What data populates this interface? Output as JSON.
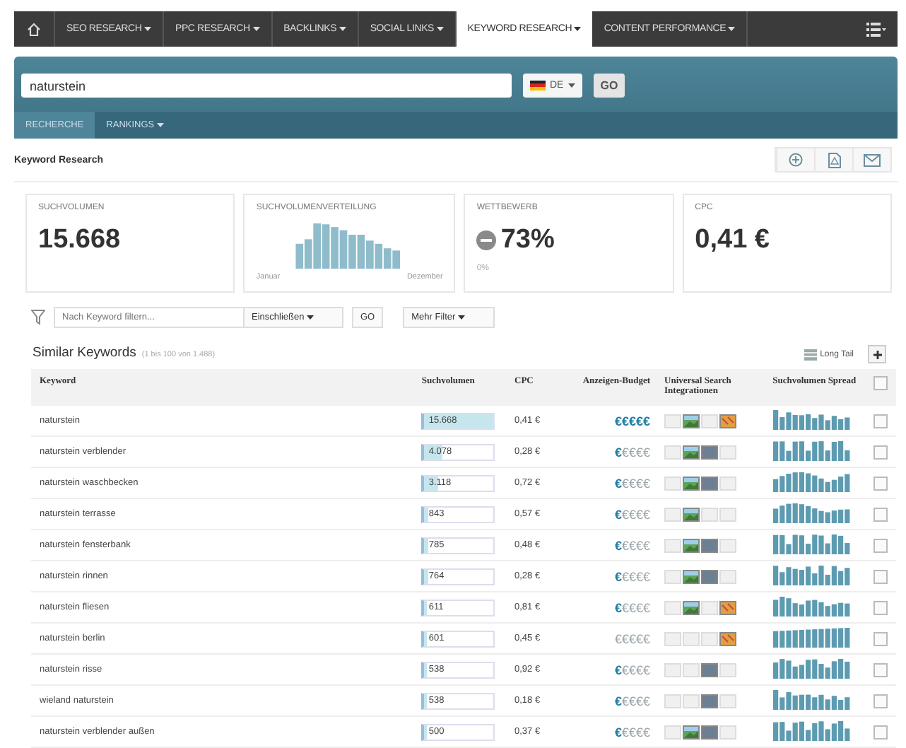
{
  "nav": {
    "items": [
      {
        "label": "SEO RESEARCH",
        "selected": false
      },
      {
        "label": "PPC RESEARCH",
        "selected": false
      },
      {
        "label": "BACKLINKS",
        "selected": false
      },
      {
        "label": "SOCIAL LINKS",
        "selected": false
      },
      {
        "label": "KEYWORD RESEARCH",
        "selected": true
      },
      {
        "label": "CONTENT PERFORMANCE",
        "selected": false
      }
    ]
  },
  "search": {
    "value": "naturstein",
    "country": "DE",
    "go": "GO"
  },
  "subtabs": [
    {
      "label": "RECHERCHE",
      "selected": true,
      "dropdown": false
    },
    {
      "label": "RANKINGS",
      "selected": false,
      "dropdown": true
    }
  ],
  "page_title": "Keyword Research",
  "cards": [
    {
      "kind": "number",
      "label": "SUCHVOLUMEN",
      "value": "15.668"
    },
    {
      "kind": "distribution",
      "label": "SUCHVOLUMENVERTEILUNG",
      "start": "Januar",
      "end": "Dezember"
    },
    {
      "kind": "competition",
      "label": "WETTBEWERB",
      "value": "73%",
      "note": "0%"
    },
    {
      "kind": "number",
      "label": "CPC",
      "value": "0,41 €"
    }
  ],
  "filter": {
    "placeholder": "Nach Keyword filtern...",
    "mode": "Einschließen",
    "go": "GO",
    "more": "Mehr Filter"
  },
  "table": {
    "title": "Similar Keywords",
    "count": "(1 bis 100 von 1.488)",
    "long_tail": "Long Tail",
    "columns": [
      "Keyword",
      "Suchvolumen",
      "CPC",
      "Anzeigen-Budget",
      "Universal Search Integrationen",
      "Suchvolumen Spread"
    ],
    "header_checked": false,
    "rows": [
      {
        "keyword": "naturstein",
        "volume": "15.668",
        "level": 1.0,
        "cpc": "0,41 €",
        "budget": [
          {
            "sign": "€",
            "on": true
          },
          {
            "sign": "€",
            "on": true
          },
          {
            "sign": "€",
            "on": true
          },
          {
            "sign": "€",
            "on": true
          },
          {
            "sign": "€",
            "on": true
          }
        ],
        "integrations": [
          {
            "kind": "news",
            "on": false
          },
          {
            "kind": "image",
            "on": true
          },
          {
            "kind": "video",
            "on": false
          },
          {
            "kind": "map",
            "on": true
          }
        ],
        "checked": false
      },
      {
        "keyword": "naturstein verblender",
        "volume": "4.078",
        "level": 0.26,
        "cpc": "0,28 €",
        "budget": [
          {
            "sign": "€",
            "on": true
          },
          {
            "sign": "€",
            "on": false
          },
          {
            "sign": "€",
            "on": false
          },
          {
            "sign": "€",
            "on": false
          },
          {
            "sign": "€",
            "on": false
          }
        ],
        "integrations": [
          {
            "kind": "news",
            "on": false
          },
          {
            "kind": "image",
            "on": true
          },
          {
            "kind": "video",
            "on": true
          },
          {
            "kind": "map",
            "on": false
          }
        ],
        "checked": false
      },
      {
        "keyword": "naturstein waschbecken",
        "volume": "3.118",
        "level": 0.2,
        "cpc": "0,72 €",
        "budget": [
          {
            "sign": "€",
            "on": true
          },
          {
            "sign": "€",
            "on": false
          },
          {
            "sign": "€",
            "on": false
          },
          {
            "sign": "€",
            "on": false
          },
          {
            "sign": "€",
            "on": false
          }
        ],
        "integrations": [
          {
            "kind": "news",
            "on": false
          },
          {
            "kind": "image",
            "on": true
          },
          {
            "kind": "video",
            "on": true
          },
          {
            "kind": "map",
            "on": false
          }
        ],
        "checked": false
      },
      {
        "keyword": "naturstein terrasse",
        "volume": "843",
        "level": 0.05,
        "cpc": "0,57 €",
        "budget": [
          {
            "sign": "€",
            "on": true
          },
          {
            "sign": "€",
            "on": false
          },
          {
            "sign": "€",
            "on": false
          },
          {
            "sign": "€",
            "on": false
          },
          {
            "sign": "€",
            "on": false
          }
        ],
        "integrations": [
          {
            "kind": "news",
            "on": false
          },
          {
            "kind": "image",
            "on": true
          },
          {
            "kind": "video",
            "on": false
          },
          {
            "kind": "map",
            "on": false
          }
        ],
        "checked": false
      },
      {
        "keyword": "naturstein fensterbank",
        "volume": "785",
        "level": 0.05,
        "cpc": "0,48 €",
        "budget": [
          {
            "sign": "€",
            "on": true
          },
          {
            "sign": "€",
            "on": false
          },
          {
            "sign": "€",
            "on": false
          },
          {
            "sign": "€",
            "on": false
          },
          {
            "sign": "€",
            "on": false
          }
        ],
        "integrations": [
          {
            "kind": "news",
            "on": false
          },
          {
            "kind": "image",
            "on": true
          },
          {
            "kind": "video",
            "on": true
          },
          {
            "kind": "map",
            "on": false
          }
        ],
        "checked": false
      },
      {
        "keyword": "naturstein rinnen",
        "volume": "764",
        "level": 0.05,
        "cpc": "0,28 €",
        "budget": [
          {
            "sign": "€",
            "on": true
          },
          {
            "sign": "€",
            "on": false
          },
          {
            "sign": "€",
            "on": false
          },
          {
            "sign": "€",
            "on": false
          },
          {
            "sign": "€",
            "on": false
          }
        ],
        "integrations": [
          {
            "kind": "news",
            "on": false
          },
          {
            "kind": "image",
            "on": true
          },
          {
            "kind": "video",
            "on": true
          },
          {
            "kind": "map",
            "on": false
          }
        ],
        "checked": false
      },
      {
        "keyword": "naturstein fliesen",
        "volume": "611",
        "level": 0.04,
        "cpc": "0,81 €",
        "budget": [
          {
            "sign": "€",
            "on": true
          },
          {
            "sign": "€",
            "on": false
          },
          {
            "sign": "€",
            "on": false
          },
          {
            "sign": "€",
            "on": false
          },
          {
            "sign": "€",
            "on": false
          }
        ],
        "integrations": [
          {
            "kind": "news",
            "on": false
          },
          {
            "kind": "image",
            "on": true
          },
          {
            "kind": "video",
            "on": false
          },
          {
            "kind": "map",
            "on": true
          }
        ],
        "checked": false
      },
      {
        "keyword": "naturstein berlin",
        "volume": "601",
        "level": 0.04,
        "cpc": "0,45 €",
        "budget": [
          {
            "sign": "€",
            "on": false
          },
          {
            "sign": "€",
            "on": false
          },
          {
            "sign": "€",
            "on": false
          },
          {
            "sign": "€",
            "on": false
          },
          {
            "sign": "€",
            "on": false
          }
        ],
        "integrations": [
          {
            "kind": "news",
            "on": false
          },
          {
            "kind": "image",
            "on": false
          },
          {
            "kind": "video",
            "on": false
          },
          {
            "kind": "map",
            "on": true
          }
        ],
        "checked": false
      },
      {
        "keyword": "naturstein risse",
        "volume": "538",
        "level": 0.03,
        "cpc": "0,92 €",
        "budget": [
          {
            "sign": "€",
            "on": true
          },
          {
            "sign": "€",
            "on": false
          },
          {
            "sign": "€",
            "on": false
          },
          {
            "sign": "€",
            "on": false
          },
          {
            "sign": "€",
            "on": false
          }
        ],
        "integrations": [
          {
            "kind": "news",
            "on": false
          },
          {
            "kind": "image",
            "on": false
          },
          {
            "kind": "video",
            "on": true
          },
          {
            "kind": "map",
            "on": false
          }
        ],
        "checked": false
      },
      {
        "keyword": "wieland naturstein",
        "volume": "538",
        "level": 0.03,
        "cpc": "0,18 €",
        "budget": [
          {
            "sign": "€",
            "on": true
          },
          {
            "sign": "€",
            "on": false
          },
          {
            "sign": "€",
            "on": false
          },
          {
            "sign": "€",
            "on": false
          },
          {
            "sign": "€",
            "on": false
          }
        ],
        "integrations": [
          {
            "kind": "news",
            "on": false
          },
          {
            "kind": "image",
            "on": false
          },
          {
            "kind": "video",
            "on": true
          },
          {
            "kind": "map",
            "on": false
          }
        ],
        "checked": false
      },
      {
        "keyword": "naturstein verblender außen",
        "volume": "500",
        "level": 0.03,
        "cpc": "0,37 €",
        "budget": [
          {
            "sign": "€",
            "on": true
          },
          {
            "sign": "€",
            "on": false
          },
          {
            "sign": "€",
            "on": false
          },
          {
            "sign": "€",
            "on": false
          },
          {
            "sign": "€",
            "on": false
          }
        ],
        "integrations": [
          {
            "kind": "news",
            "on": false
          },
          {
            "kind": "image",
            "on": true
          },
          {
            "kind": "video",
            "on": true
          },
          {
            "kind": "map",
            "on": false
          }
        ],
        "checked": false
      }
    ]
  }
}
